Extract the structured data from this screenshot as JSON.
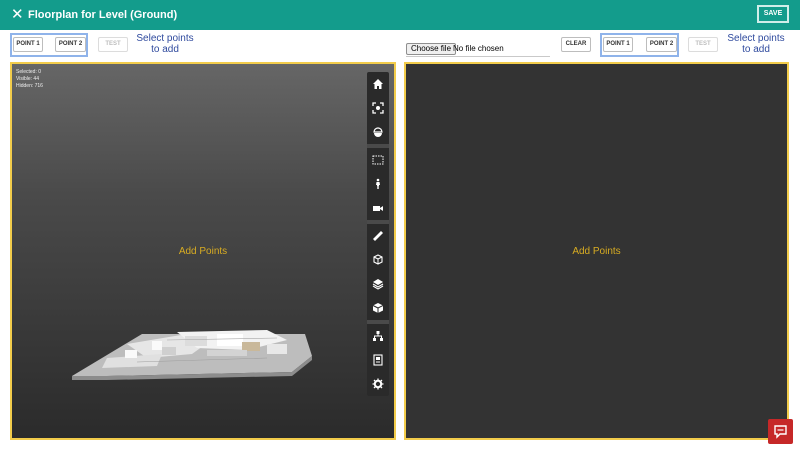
{
  "header": {
    "title": "Floorplan for Level (Ground)",
    "close_glyph": "✕",
    "save_label": "SAVE",
    "background": "#139c8c"
  },
  "left_panel": {
    "point1_label": "POINT 1",
    "point2_label": "POINT 2",
    "test_label": "TEST",
    "hint": "Select points to add",
    "stats": {
      "selected": "Selected: 0",
      "visible": "Visible: 44",
      "hidden": "Hidden: 716"
    },
    "add_points_label": "Add Points",
    "toolbar_icons": [
      "home-icon",
      "fit-view-icon",
      "section-icon",
      "box-select-icon",
      "walk-icon",
      "camera-icon",
      "measure-icon",
      "explode-icon",
      "layers-icon",
      "model-icon",
      "tree-icon",
      "properties-icon",
      "settings-icon"
    ]
  },
  "right_panel": {
    "choose_file_label": "Choose file",
    "file_status": "No file chosen",
    "clear_label": "CLEAR",
    "point1_label": "POINT 1",
    "point2_label": "POINT 2",
    "test_label": "TEST",
    "hint": "Select points to add",
    "add_points_label": "Add Points"
  },
  "colors": {
    "viewer_border": "#f2cc4b",
    "add_points_text": "#d8ac22",
    "hint_text": "#2f4a9e",
    "point_group_border": "#8fb3ea",
    "chat_button": "#c62828"
  },
  "chat_icon": "chat-icon"
}
